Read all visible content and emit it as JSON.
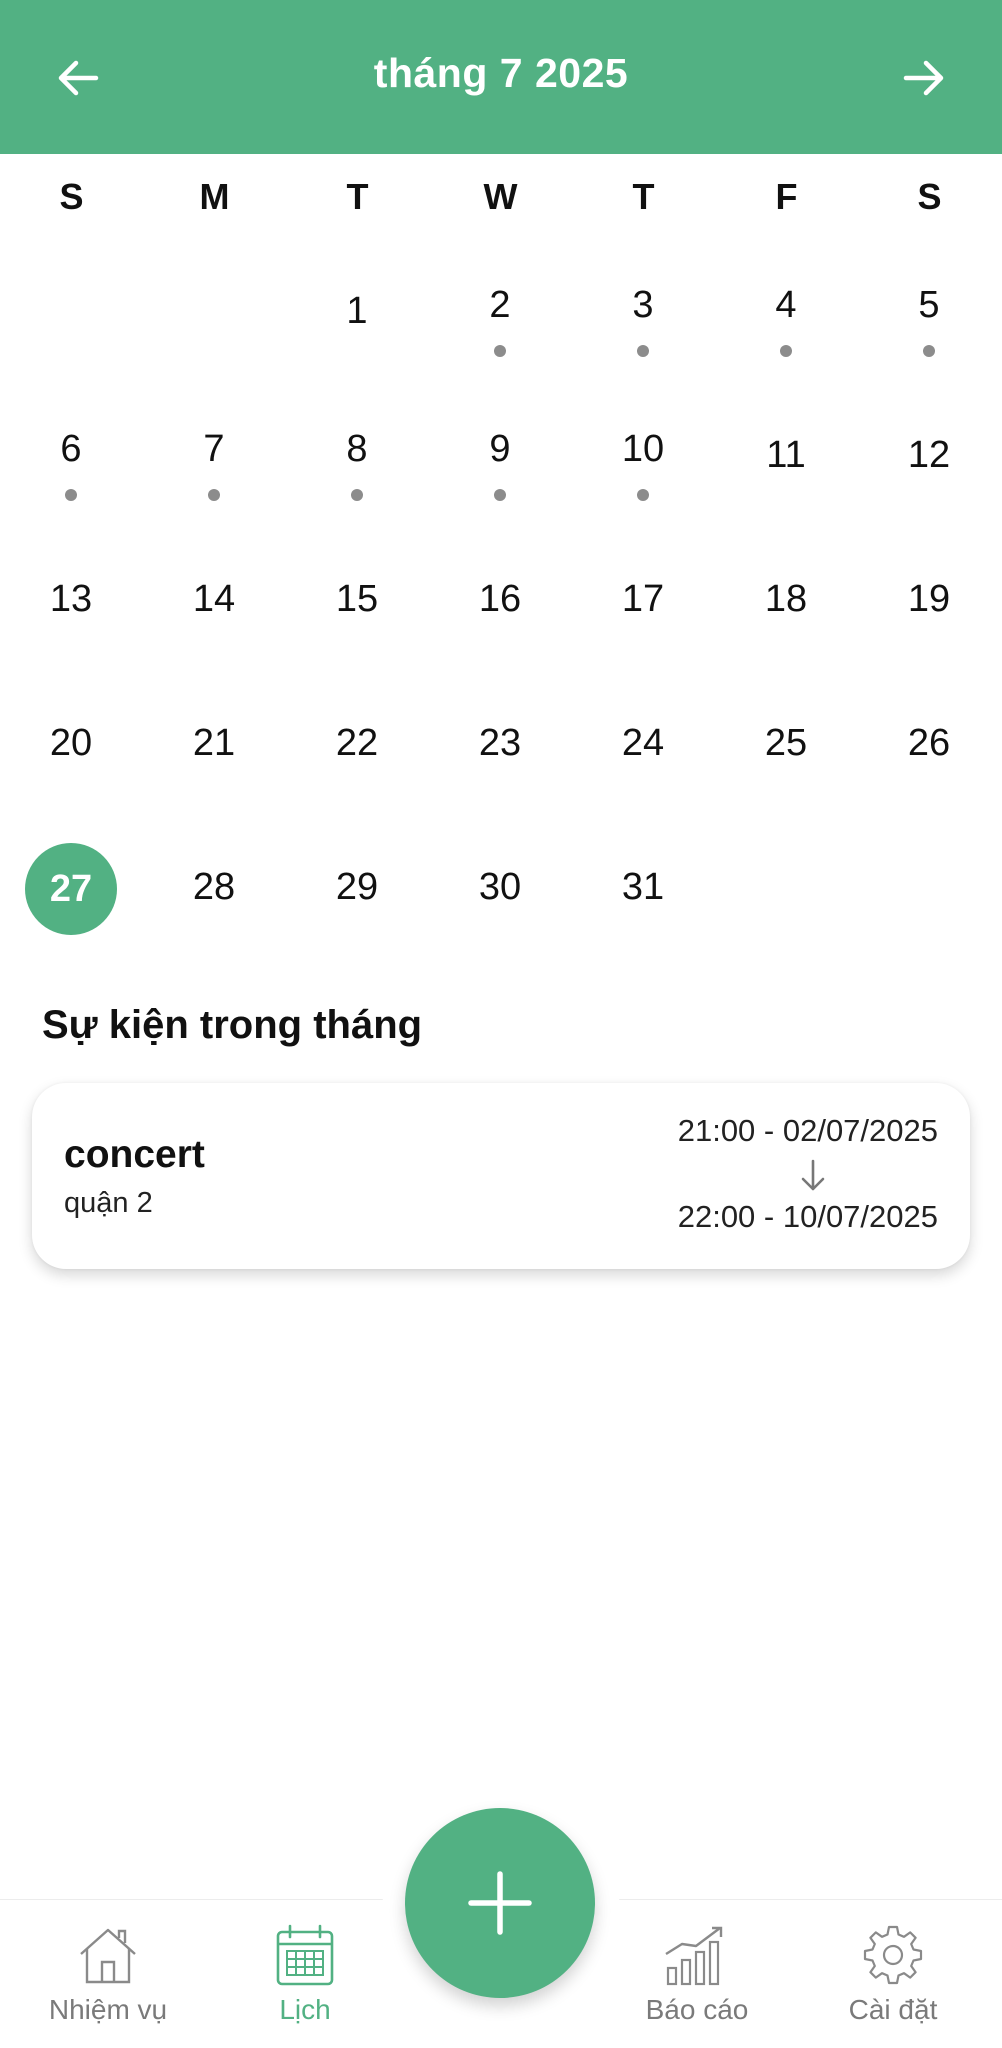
{
  "header": {
    "title": "tháng 7 2025",
    "prev_icon": "arrow-left-icon",
    "next_icon": "arrow-right-icon",
    "color": "#52b183"
  },
  "weekdays": [
    "S",
    "M",
    "T",
    "W",
    "T",
    "F",
    "S"
  ],
  "calendar": {
    "today": "27",
    "weeks": [
      [
        null,
        null,
        {
          "n": "1"
        },
        {
          "n": "2",
          "dot": true
        },
        {
          "n": "3",
          "dot": true
        },
        {
          "n": "4",
          "dot": true
        },
        {
          "n": "5",
          "dot": true
        }
      ],
      [
        {
          "n": "6",
          "dot": true
        },
        {
          "n": "7",
          "dot": true
        },
        {
          "n": "8",
          "dot": true
        },
        {
          "n": "9",
          "dot": true
        },
        {
          "n": "10",
          "dot": true
        },
        {
          "n": "11"
        },
        {
          "n": "12"
        }
      ],
      [
        {
          "n": "13"
        },
        {
          "n": "14"
        },
        {
          "n": "15"
        },
        {
          "n": "16"
        },
        {
          "n": "17"
        },
        {
          "n": "18"
        },
        {
          "n": "19"
        }
      ],
      [
        {
          "n": "20"
        },
        {
          "n": "21"
        },
        {
          "n": "22"
        },
        {
          "n": "23"
        },
        {
          "n": "24"
        },
        {
          "n": "25"
        },
        {
          "n": "26"
        }
      ],
      [
        {
          "n": "27",
          "today": true
        },
        {
          "n": "28"
        },
        {
          "n": "29"
        },
        {
          "n": "30"
        },
        {
          "n": "31"
        },
        null,
        null
      ]
    ]
  },
  "events_section": {
    "title": "Sự kiện trong tháng",
    "events": [
      {
        "title": "concert",
        "location": "quận 2",
        "start": "21:00 - 02/07/2025",
        "end": "22:00 - 10/07/2025",
        "arrow_icon": "arrow-down-icon"
      }
    ]
  },
  "bottom_nav": {
    "items": [
      {
        "label": "Nhiệm vụ",
        "icon": "home-icon",
        "active": false
      },
      {
        "label": "Lịch",
        "icon": "calendar-icon",
        "active": true
      },
      {
        "label": "Báo cáo",
        "icon": "bar-chart-icon",
        "active": false
      },
      {
        "label": "Cài đặt",
        "icon": "gear-icon",
        "active": false
      }
    ],
    "fab_icon": "plus-icon"
  }
}
